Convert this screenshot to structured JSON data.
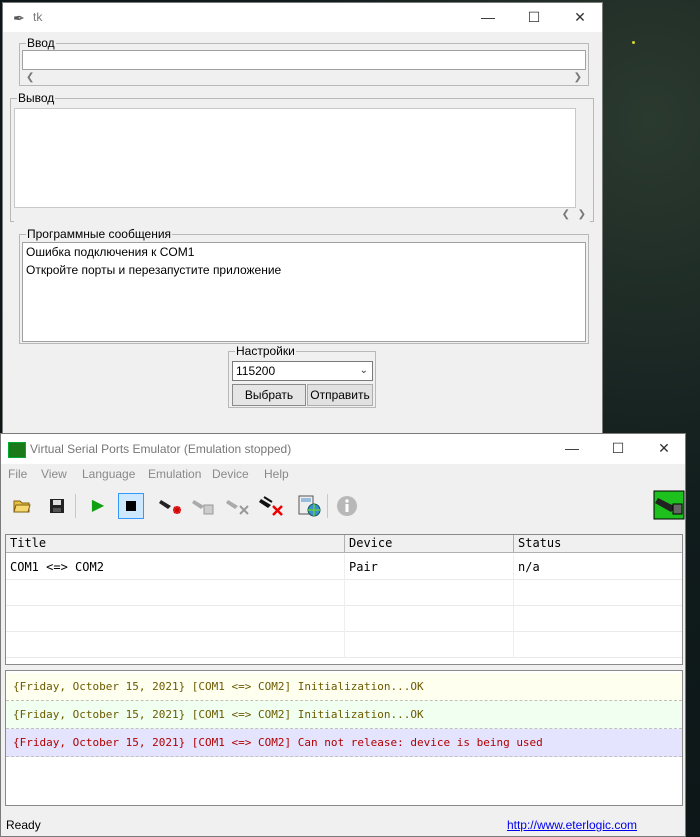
{
  "tk": {
    "title": "tk",
    "input_group": {
      "label": "Ввод",
      "value": ""
    },
    "output_group": {
      "label": "Вывод"
    },
    "messages_group": {
      "label": "Программные сообщения",
      "lines": [
        "Ошибка подключения к COM1",
        "Откройте порты и перезапустите приложение"
      ]
    },
    "settings_group": {
      "label": "Настройки",
      "baud_value": "115200",
      "select_label": "Выбрать",
      "send_label": "Отправить"
    }
  },
  "vspe": {
    "title": "Virtual Serial Ports Emulator (Emulation stopped)",
    "menu": [
      "File",
      "View",
      "Language",
      "Emulation",
      "Device",
      "Help"
    ],
    "toolbar_icons": [
      "open-folder-icon",
      "save-icon",
      "start-emulation-icon",
      "stop-emulation-icon",
      "create-device-icon",
      "edit-device-icon",
      "remove-device-icon",
      "delete-device-icon",
      "calculator-globe-icon",
      "info-icon"
    ],
    "table": {
      "columns": [
        "Title",
        "Device",
        "Status"
      ],
      "rows": [
        {
          "title": "COM1 <=> COM2",
          "device": "Pair",
          "status": "n/a"
        }
      ]
    },
    "log": [
      {
        "text": "{Friday, October 15, 2021} [COM1 <=> COM2] Initialization...OK",
        "color": "#6b5a00",
        "bg": "#fffff0"
      },
      {
        "text": "{Friday, October 15, 2021} [COM1 <=> COM2] Initialization...OK",
        "color": "#6b5a00",
        "bg": "#f0fff0"
      },
      {
        "text": "{Friday, October 15, 2021} [COM1 <=> COM2] Can not release: device is being used",
        "color": "#b00000",
        "bg": "#e4e4ff"
      }
    ],
    "status": "Ready",
    "link": "http://www.eterlogic.com"
  }
}
